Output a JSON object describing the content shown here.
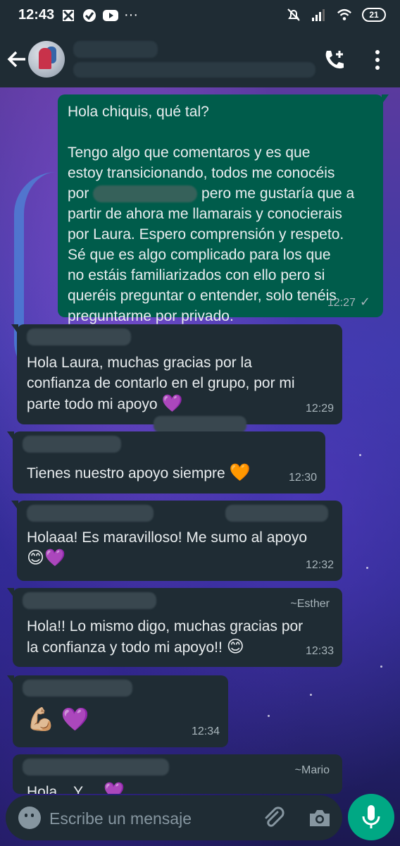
{
  "status_bar": {
    "time": "12:43",
    "dots": "···",
    "battery": "21"
  },
  "header": {
    "avatar_alt": "contact-avatar"
  },
  "messages": [
    {
      "direction": "out",
      "line1": "Hola chiquis, qué tal?",
      "para_start": "Tengo algo que comentaros y es que\nestoy transicionando, todos me conocéis\npor",
      "para_mid": "pero me gustaría que a",
      "para_end": "partir de ahora me llamarais y conocierais\npor Laura. Espero comprensión y respeto.\nSé que es algo complicado para los que\nno estáis familiarizados con ello pero si\nqueréis preguntar o entender, solo tenéis\npreguntarme por privado.",
      "time": "12:27",
      "status": "✓"
    },
    {
      "direction": "in",
      "text": "Hola Laura, muchas gracias por la\nconfianza de contarlo en el grupo, por mi\nparte todo mi apoyo",
      "emoji": "💜",
      "time": "12:29"
    },
    {
      "direction": "in",
      "text": "Tienes nuestro apoyo siempre",
      "emoji": "🧡",
      "time": "12:30"
    },
    {
      "direction": "in",
      "text": "Holaaa! Es maravilloso! Me sumo al apoyo",
      "emoji": "😊💜",
      "time": "12:32"
    },
    {
      "direction": "in",
      "author": "~Esther",
      "text": "Hola!! Lo mismo digo, muchas gracias por\nla confianza y todo mi apoyo!!",
      "emoji": "😊",
      "time": "12:33"
    },
    {
      "direction": "in",
      "emoji": "💪🏼 💜",
      "time": "12:34"
    },
    {
      "direction": "in",
      "author": "~Mario",
      "text": "Hola... Y ...",
      "emoji": "💜"
    }
  ],
  "composer": {
    "placeholder": "Escribe un mensaje"
  },
  "colors": {
    "outgoing": "#005c4b",
    "incoming": "#1f2c34",
    "accent": "#00a884"
  }
}
